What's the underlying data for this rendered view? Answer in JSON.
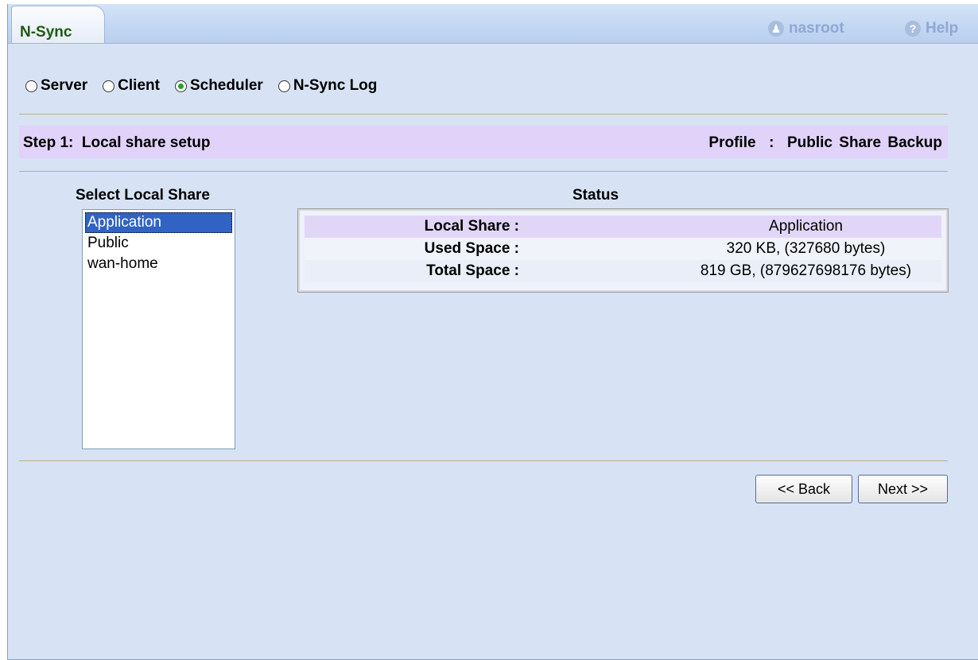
{
  "tab": {
    "label": "N-Sync"
  },
  "header": {
    "user": "nasroot",
    "user_icon": "person-icon",
    "help": "Help",
    "help_icon": "question-icon"
  },
  "mode": {
    "options": [
      "Server",
      "Client",
      "Scheduler",
      "N-Sync Log"
    ],
    "selected": "Scheduler"
  },
  "step": {
    "title": "Step 1:  Local share setup",
    "profile": "Profile  :  Public Share Backup"
  },
  "local_share": {
    "title": "Select Local Share",
    "items": [
      "Application",
      "Public",
      "wan-home"
    ],
    "selected": "Application"
  },
  "status": {
    "title": "Status",
    "rows": [
      {
        "label": "Local Share :",
        "value": "Application"
      },
      {
        "label": "Used Space :",
        "value": "320 KB, (327680 bytes)"
      },
      {
        "label": "Total Space :",
        "value": "819 GB, (879627698176 bytes)"
      }
    ]
  },
  "buttons": {
    "back": "<< Back",
    "next": "Next >>"
  },
  "colors": {
    "panel": "#d7e3f4",
    "step_bar": "#e0d2f8",
    "selection": "#3163c5",
    "tab_text": "#1d5a12"
  }
}
